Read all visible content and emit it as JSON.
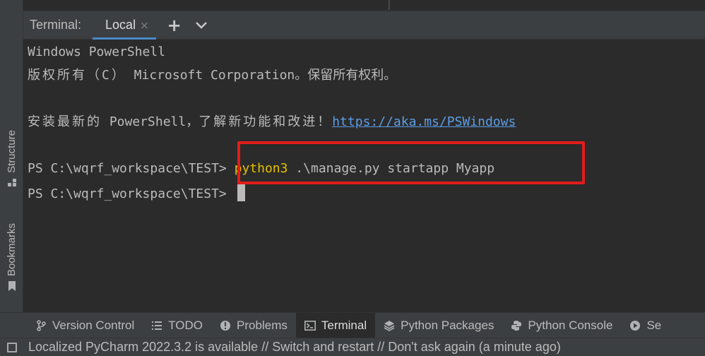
{
  "left_stripe": {
    "structure_label": "Structure",
    "bookmarks_label": "Bookmarks"
  },
  "terminal_header": {
    "title": "Terminal:",
    "tab_label": "Local",
    "close_glyph": "×",
    "add_glyph": "+"
  },
  "terminal": {
    "line1": "Windows PowerShell",
    "line2_prefix": "版权所有（C）",
    "line2_suffix": " Microsoft Corporation。保留所有权利。",
    "line4_prefix": "安装最新的",
    "line4_middle": " PowerShell，",
    "line4_cjk": "了解新功能和改进！",
    "line4_link": "https://aka.ms/PSWindows",
    "prompt1": "PS C:\\wqrf_workspace\\TEST> ",
    "cmd_python": "python3",
    "cmd_rest": " .\\manage.py startapp Myapp",
    "prompt2": "PS C:\\wqrf_workspace\\TEST> "
  },
  "bottom_tools": [
    {
      "label": "Version Control",
      "icon": "branch-icon"
    },
    {
      "label": "TODO",
      "icon": "list-icon"
    },
    {
      "label": "Problems",
      "icon": "info-icon"
    },
    {
      "label": "Terminal",
      "icon": "terminal-icon"
    },
    {
      "label": "Python Packages",
      "icon": "layers-icon"
    },
    {
      "label": "Python Console",
      "icon": "python-icon"
    },
    {
      "label": "Se",
      "icon": "play-icon"
    }
  ],
  "status_bar": {
    "message": "Localized PyCharm 2022.3.2 is available // Switch and restart // Don't ask again (a minute ago)"
  },
  "colors": {
    "accent": "#4a88c7",
    "highlight_box": "#e21c1c",
    "link": "#5c9de6",
    "command": "#e6c000"
  }
}
